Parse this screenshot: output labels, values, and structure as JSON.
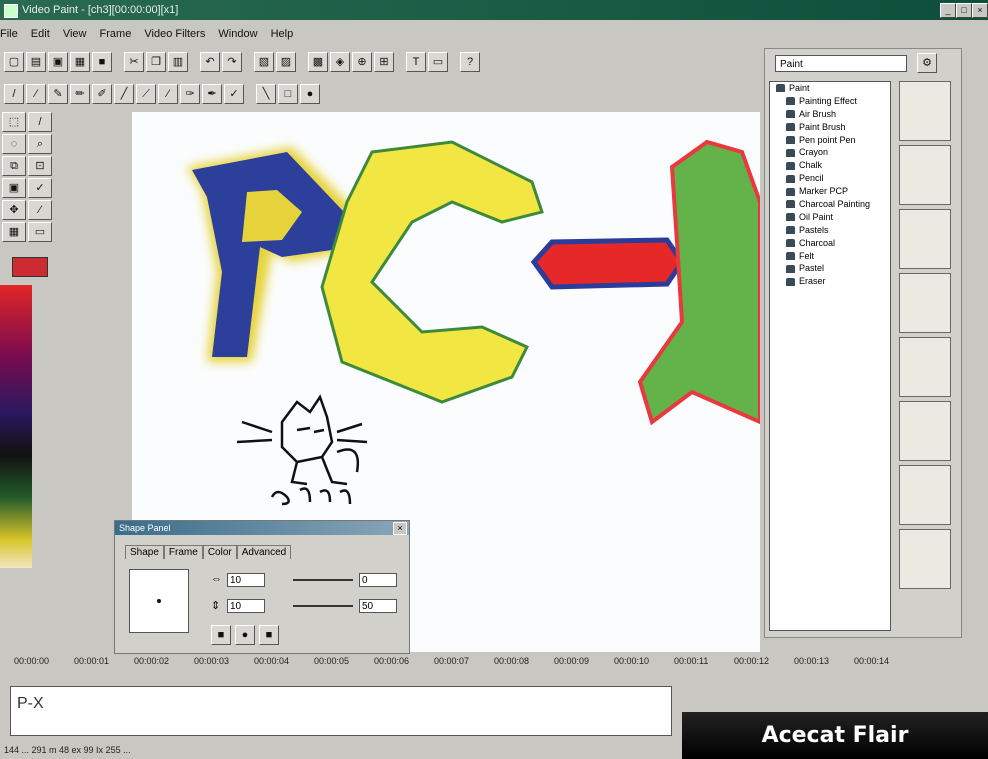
{
  "window": {
    "title": "Video Paint - [ch3][00:00:00][x1]",
    "controls": [
      "_",
      "□",
      "×"
    ]
  },
  "menu": [
    "File",
    "Edit",
    "View",
    "Frame",
    "Video Filters",
    "Window",
    "Help"
  ],
  "brushes": {
    "selected": "Paint",
    "category": "Paint",
    "items": [
      "Painting Effect",
      "Air Brush",
      "Paint Brush",
      "Pen point Pen",
      "Crayon",
      "Chalk",
      "Pencil",
      "Marker PCP",
      "Charcoal Painting",
      "Oil Paint",
      "Pastels",
      "Charcoal",
      "Felt",
      "Pastel",
      "Eraser"
    ]
  },
  "shape_panel": {
    "title": "Shape Panel",
    "tabs": [
      "Shape",
      "Frame",
      "Color",
      "Advanced"
    ],
    "fields": {
      "width": "10",
      "height": "10",
      "value_a": "0",
      "value_b": "50"
    }
  },
  "timeline": [
    "00:00:00",
    "00:00:01",
    "00:00:02",
    "00:00:03",
    "00:00:04",
    "00:00:05",
    "00:00:06",
    "00:00:07",
    "00:00:08",
    "00:00:09",
    "00:00:10",
    "00:00:11",
    "00:00:12",
    "00:00:13",
    "00:00:14"
  ],
  "track_label": "P-X",
  "status": "144 ... 291 m 48 ex 99 Ix 255 ...",
  "overlay_caption": "Acecat Flair",
  "colors": {
    "foreground": "#cc2b31",
    "title_bar": "#0c4f3a"
  }
}
